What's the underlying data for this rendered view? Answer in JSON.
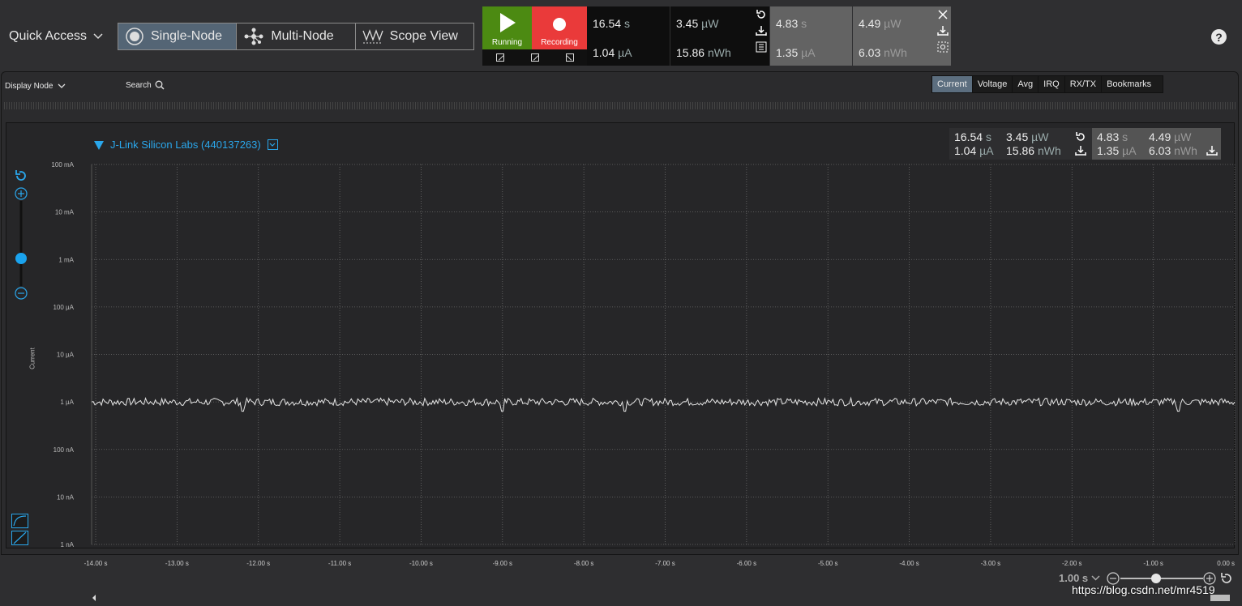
{
  "toolbar": {
    "quick_access": "Quick Access",
    "modes": [
      {
        "label": "Single-Node",
        "icon": "single-node-icon",
        "active": true
      },
      {
        "label": "Multi-Node",
        "icon": "multi-node-icon",
        "active": false
      },
      {
        "label": "Scope View",
        "icon": "scope-view-icon",
        "active": false
      }
    ],
    "run_label": "Running",
    "record_label": "Recording",
    "run_color": "#4c8a12",
    "record_color": "#ea3a3a",
    "accent": "#2aa7ec"
  },
  "live_measurements": {
    "time_value": "16.54",
    "time_unit": "s",
    "current_value": "1.04",
    "current_unit": "µA",
    "power_value": "3.45",
    "power_unit": "µW",
    "energy_value": "15.86",
    "energy_unit": "nWh"
  },
  "selection_measurements": {
    "time_value": "4.83",
    "time_unit": "s",
    "current_value": "1.35",
    "current_unit": "µA",
    "power_value": "4.49",
    "power_unit": "µW",
    "energy_value": "6.03",
    "energy_unit": "nWh"
  },
  "panel": {
    "display_node": "Display Node",
    "search": "Search",
    "tabs": [
      {
        "label": "Current",
        "active": true
      },
      {
        "label": "Voltage",
        "active": false
      },
      {
        "label": "Avg",
        "active": false
      },
      {
        "label": "IRQ",
        "active": false
      },
      {
        "label": "RX/TX",
        "active": false
      },
      {
        "label": "Bookmarks",
        "active": false
      }
    ]
  },
  "node": {
    "name": "J-Link Silicon Labs (440137263)"
  },
  "chart_data": {
    "type": "line",
    "title": "",
    "ylabel": "Current",
    "yscale": "log",
    "y_ticks": [
      "100 mA",
      "10 mA",
      "1 mA",
      "100 µA",
      "10 µA",
      "1 µA",
      "100 nA",
      "10 nA",
      "1 nA"
    ],
    "x_ticks": [
      "-14.00 s",
      "-13.00 s",
      "-12.00 s",
      "-11.00 s",
      "-10.00 s",
      "-9.00 s",
      "-8.00 s",
      "-7.00 s",
      "-6.00 s",
      "-5.00 s",
      "-4.00 s",
      "-3.00 s",
      "-2.00 s",
      "-1.00 s",
      "0.00 s"
    ],
    "xlim": [
      -14.05,
      0
    ],
    "series": [
      {
        "baseline_uA": 1.0,
        "noise_range_uA": [
          0.75,
          1.35
        ],
        "dip_times_s": [
          -12.2,
          -9.0,
          -7.5,
          -0.7
        ],
        "color": "#e6e6e6"
      }
    ],
    "grid": true
  },
  "timebase": {
    "value": "1.00 s"
  },
  "watermark": "https://blog.csdn.net/mr4519"
}
